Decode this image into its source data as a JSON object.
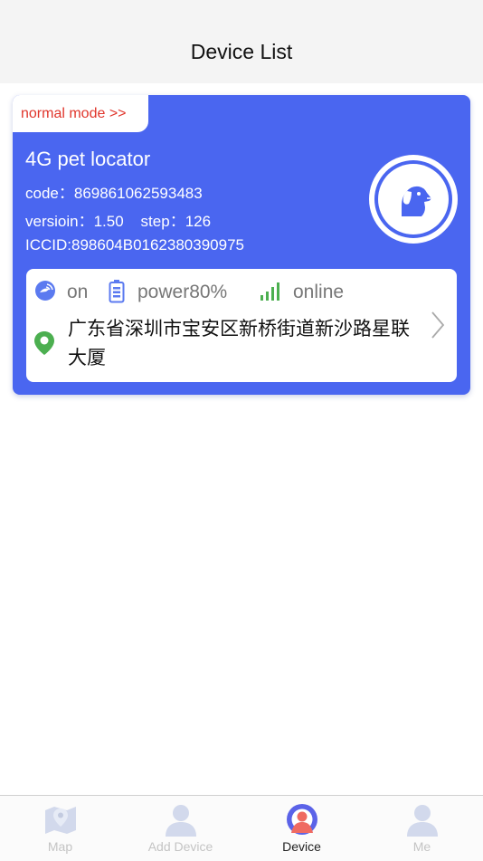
{
  "header": {
    "title": "Device List"
  },
  "device": {
    "mode_label": "normal mode >>",
    "name": "4G pet locator",
    "code": "code：869861062593483",
    "version_step": "versioin：1.50    step：126",
    "iccid": "ICCID:898604B0162380390975",
    "avatar_icon": "dog-icon",
    "status": {
      "gps": "on",
      "power": "power80%",
      "network": "online"
    },
    "address": "广东省深圳市宝安区新桥街道新沙路星联大厦"
  },
  "tabs": [
    {
      "label": "Map",
      "icon": "map-icon"
    },
    {
      "label": "Add Device",
      "icon": "person-icon"
    },
    {
      "label": "Device",
      "icon": "device-icon",
      "active": true
    },
    {
      "label": "Me",
      "icon": "person-icon"
    }
  ],
  "colors": {
    "card": "#4a66f0",
    "mode_text": "#e0352b",
    "signal": "#4caf50",
    "location": "#4caf50"
  }
}
